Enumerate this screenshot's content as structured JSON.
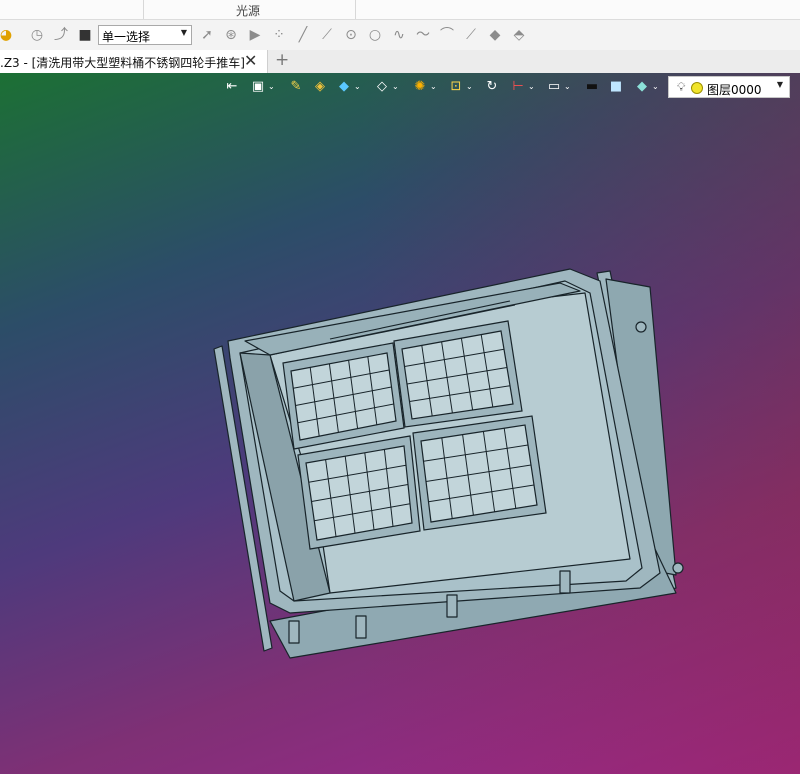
{
  "ribbon": {
    "group_label": "光源"
  },
  "quick_toolbar": {
    "icons": [
      "app-logo-icon",
      "history-icon",
      "step-icon",
      "stop-icon",
      "pointer-icon",
      "pick-icon",
      "play-icon",
      "points-icon",
      "line-icon",
      "segment-icon",
      "circle-point-icon",
      "circle-icon",
      "spline-icon",
      "curve-icon",
      "arc-icon",
      "sketch-line-icon",
      "surface-icon",
      "layer-shape-icon"
    ],
    "select_mode": "单一选择"
  },
  "tabs": {
    "document_title": ".Z3 - [清洗用带大型塑料桶不锈钢四轮手推车]",
    "close_symbol": "✕",
    "new_tab_symbol": "+"
  },
  "view_toolbar": {
    "icons": [
      "exit-icon",
      "view-mode-icon",
      "wrench-icon",
      "shaded-cube-icon",
      "cube-icon",
      "white-cube-icon",
      "color-wheel-icon",
      "zoom-fit-icon",
      "rotate-icon",
      "dimension-icon",
      "display-icon",
      "background-black-icon",
      "background-white-icon",
      "plane-icon"
    ],
    "layer": "图层0000"
  },
  "colors": {
    "viewport_top": "#1c7034",
    "viewport_bottom": "#a22690",
    "model": "#9fb7bf",
    "model_edge": "#18242a"
  }
}
